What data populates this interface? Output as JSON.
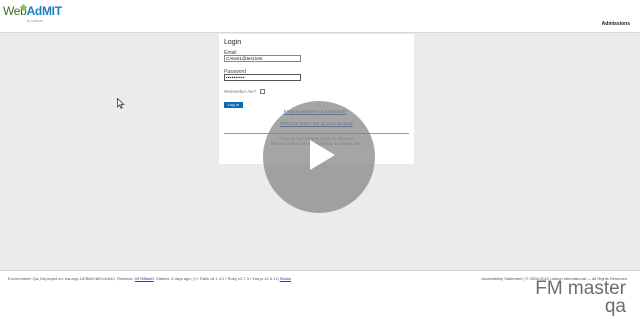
{
  "header": {
    "logo_text_web": "Web",
    "logo_text_admit": "AdMIT",
    "logo_sub": "by LIAISON",
    "admissions_link": "Admissions"
  },
  "login": {
    "title": "Login",
    "email_label": "Email",
    "email_value": "CAtest1@test.test",
    "password_label": "Password",
    "password_value": "••••••••••",
    "remember_label": "Remember me?",
    "remember_checked": false,
    "login_button": "Log In",
    "forgot_link": "Forgot username or password?",
    "first_time_link": "First time here? Set up your account",
    "no_account_line1": "If you do not already have an account,",
    "no_account_line2": "Please contact an administrator to create one."
  },
  "footer": {
    "environment": "Environment: Qa; Deployed on: wa-app-1878687469-r4dt4C; Revision:",
    "revision_link": "0576f8ad0",
    "started": "; Started: 3 days ago; (+/- Rails v6.1.3.2 / Ruby v2.7.3 / Vue.js v2.6.11)",
    "status_link": "Status",
    "accessibility": "Accessibility Statement | © 2006-2022 Liaison International — All Rights Reserved"
  },
  "overlay": {
    "watermark_line1": "FM master",
    "watermark_line2": "qa",
    "play_icon": "play-icon"
  },
  "colors": {
    "accent_blue": "#0a6cb3",
    "logo_green": "#8cc63f",
    "page_bg": "#ebebeb"
  }
}
